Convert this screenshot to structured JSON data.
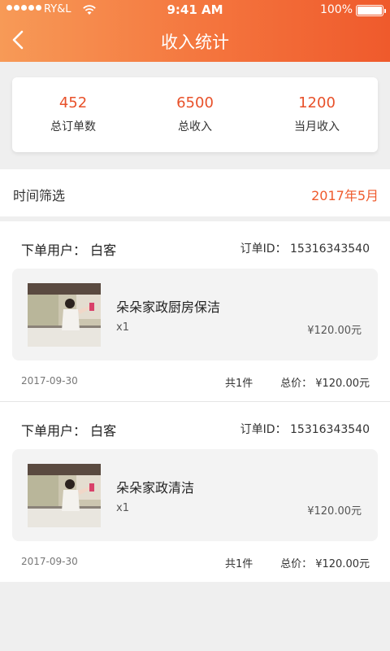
{
  "status_bar": {
    "carrier": "RY&L",
    "time": "9:41 AM",
    "battery": "100%"
  },
  "header": {
    "title": "收入统计"
  },
  "stats": [
    {
      "value": "452",
      "label": "总订单数"
    },
    {
      "value": "6500",
      "label": "总收入"
    },
    {
      "value": "1200",
      "label": "当月收入"
    }
  ],
  "filter": {
    "label": "时间筛选",
    "value": "2017年5月"
  },
  "orders": [
    {
      "user": "下单用户：  白客",
      "order_id": "订单ID：  15316343540",
      "item_name": "朵朵家政厨房保洁",
      "qty": "x1",
      "price": "¥120.00元",
      "date": "2017-09-30",
      "count": "共1件",
      "total": "总价：  ¥120.00元"
    },
    {
      "user": "下单用户：  白客",
      "order_id": "订单ID：  15316343540",
      "item_name": "朵朵家政清洁",
      "qty": "x1",
      "price": "¥120.00元",
      "date": "2017-09-30",
      "count": "共1件",
      "total": "总价：  ¥120.00元"
    }
  ],
  "colors": {
    "accent": "#ef5a2c",
    "header_start": "#f79a57",
    "header_end": "#ef5a2c"
  },
  "icons": {
    "back": "back-arrow-icon",
    "wifi": "wifi-icon",
    "battery": "battery-icon",
    "signal": "signal-dots-icon"
  }
}
